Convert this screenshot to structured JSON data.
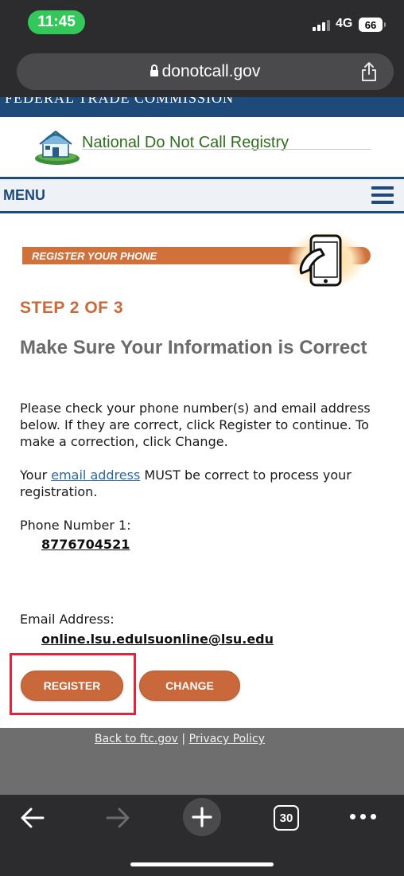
{
  "status_bar": {
    "time": "11:45",
    "network": "4G",
    "battery": "66"
  },
  "browser": {
    "url": "donotcall.gov",
    "tab_count": "30"
  },
  "site": {
    "agency_banner": "FEDERAL TRADE COMMISSION",
    "registry_title": "National Do Not Call Registry",
    "menu_label": "MENU",
    "section_banner": "REGISTER YOUR PHONE"
  },
  "form": {
    "step": "STEP 2 OF 3",
    "heading": "Make Sure Your Information is Correct",
    "instructions": "Please check your phone number(s) and email address below. If they are correct, click Register to continue. To make a correction, click Change.",
    "email_notice": {
      "prefix": "Your ",
      "link": "email address",
      "suffix": " MUST be correct to process your registration."
    },
    "phone_label": "Phone Number 1:",
    "phone_value": "8776704521",
    "email_label": "Email Address:",
    "email_value": "online.lsu.edulsuonline@lsu.edu",
    "register_label": "REGISTER",
    "change_label": "CHANGE"
  },
  "footer": {
    "back_link": "Back to ftc.gov",
    "separator": "|",
    "privacy_link": "Privacy Policy"
  },
  "colors": {
    "accent_orange": "#c9683a",
    "navy": "#1e4a7a",
    "highlight_red": "#e0243c",
    "brand_green": "#2f6e1e"
  }
}
